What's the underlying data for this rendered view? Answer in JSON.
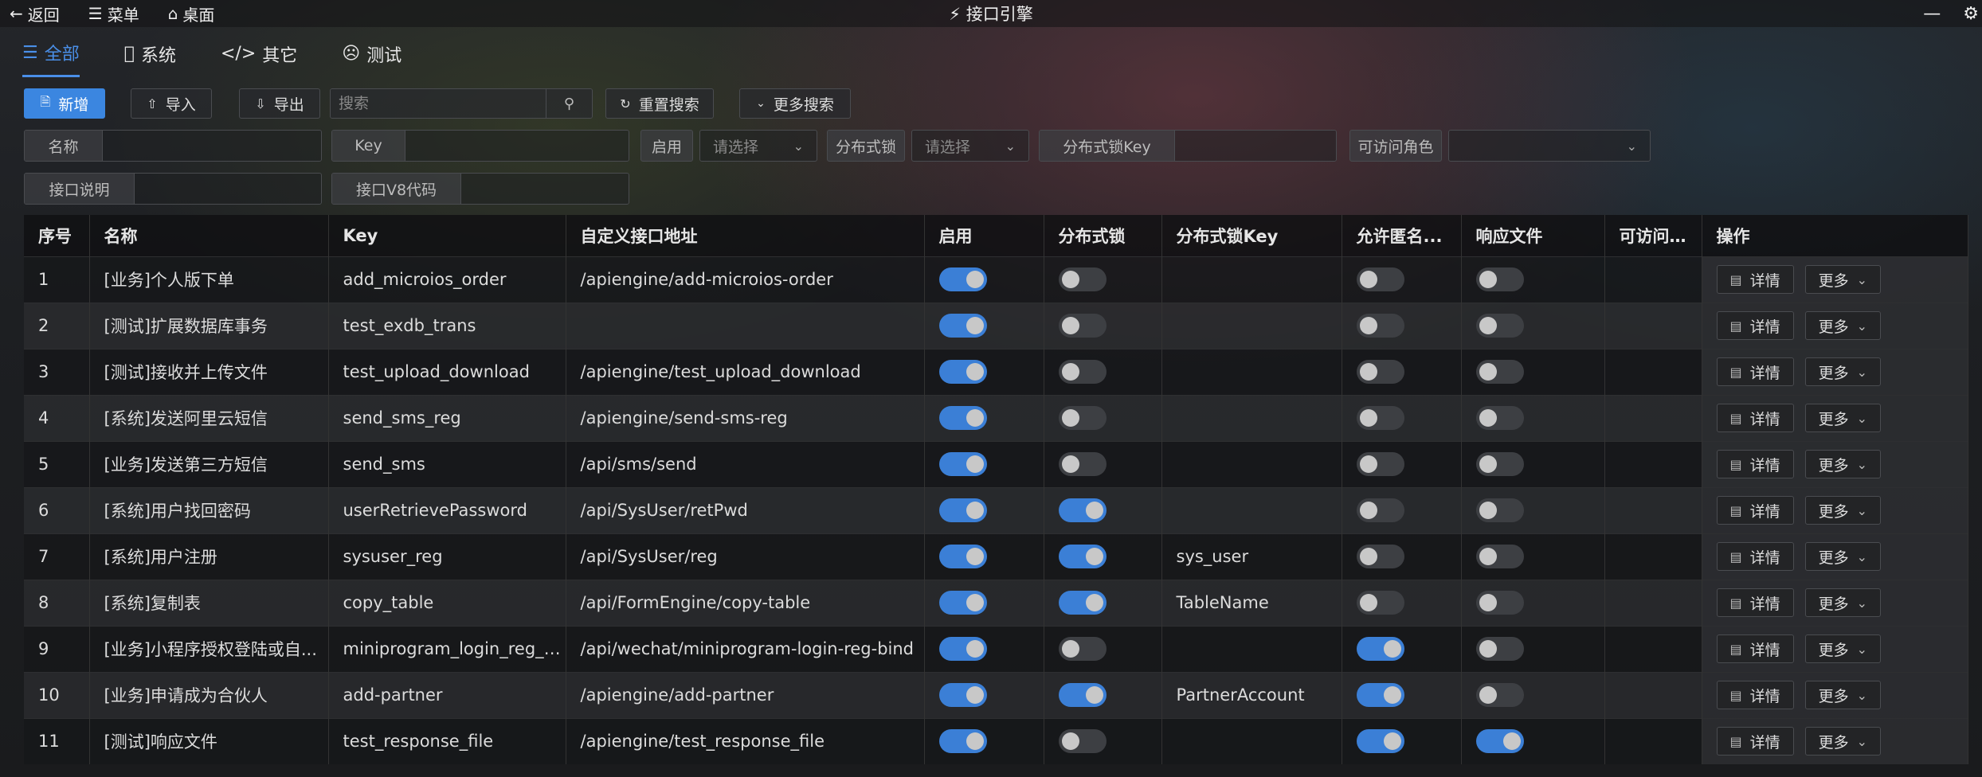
{
  "titlebar": {
    "back": "返回",
    "menu": "菜单",
    "desktop": "桌面",
    "title": "接口引擎",
    "title_icon": "plug-icon"
  },
  "tabs": [
    {
      "label": "全部",
      "icon": "list-icon",
      "active": true
    },
    {
      "label": "系统",
      "icon": "apple-icon",
      "active": false
    },
    {
      "label": "其它",
      "icon": "code-icon",
      "active": false
    },
    {
      "label": "测试",
      "icon": "face-icon",
      "active": false
    }
  ],
  "toolbar": {
    "add": "新增",
    "import": "导入",
    "export": "导出",
    "search_placeholder": "搜索",
    "reset_search": "重置搜索",
    "more_search": "更多搜索"
  },
  "filters": {
    "name": "名称",
    "key": "Key",
    "enabled": "启用",
    "enabled_placeholder": "请选择",
    "dist_lock": "分布式锁",
    "dist_lock_placeholder": "请选择",
    "dist_lock_key": "分布式锁Key",
    "roles": "可访问角色",
    "desc": "接口说明",
    "v8code": "接口V8代码"
  },
  "table": {
    "headers": [
      "序号",
      "名称",
      "Key",
      "自定义接口地址",
      "启用",
      "分布式锁",
      "分布式锁Key",
      "允许匿名...",
      "响应文件",
      "可访问角色",
      "操作"
    ],
    "detail_label": "详情",
    "more_label": "更多",
    "rows": [
      {
        "no": "1",
        "name": "[业务]个人版下单",
        "key": "add_microios_order",
        "url": "/apiengine/add-microios-order",
        "enabled": true,
        "lock": false,
        "lock_key": "",
        "anon": false,
        "resp": false,
        "roles": ""
      },
      {
        "no": "2",
        "name": "[测试]扩展数据库事务",
        "key": "test_exdb_trans",
        "url": "",
        "enabled": true,
        "lock": false,
        "lock_key": "",
        "anon": false,
        "resp": false,
        "roles": ""
      },
      {
        "no": "3",
        "name": "[测试]接收并上传文件",
        "key": "test_upload_download",
        "url": "/apiengine/test_upload_download",
        "enabled": true,
        "lock": false,
        "lock_key": "",
        "anon": false,
        "resp": false,
        "roles": ""
      },
      {
        "no": "4",
        "name": "[系统]发送阿里云短信",
        "key": "send_sms_reg",
        "url": "/apiengine/send-sms-reg",
        "enabled": true,
        "lock": false,
        "lock_key": "",
        "anon": false,
        "resp": false,
        "roles": ""
      },
      {
        "no": "5",
        "name": "[业务]发送第三方短信",
        "key": "send_sms",
        "url": "/api/sms/send",
        "enabled": true,
        "lock": false,
        "lock_key": "",
        "anon": false,
        "resp": false,
        "roles": ""
      },
      {
        "no": "6",
        "name": "[系统]用户找回密码",
        "key": "userRetrievePassword",
        "url": "/api/SysUser/retPwd",
        "enabled": true,
        "lock": true,
        "lock_key": "",
        "anon": false,
        "resp": false,
        "roles": ""
      },
      {
        "no": "7",
        "name": "[系统]用户注册",
        "key": "sysuser_reg",
        "url": "/api/SysUser/reg",
        "enabled": true,
        "lock": true,
        "lock_key": "sys_user",
        "anon": false,
        "resp": false,
        "roles": ""
      },
      {
        "no": "8",
        "name": "[系统]复制表",
        "key": "copy_table",
        "url": "/api/FormEngine/copy-table",
        "enabled": true,
        "lock": true,
        "lock_key": "TableName",
        "anon": false,
        "resp": false,
        "roles": ""
      },
      {
        "no": "9",
        "name": "[业务]小程序授权登陆或自...",
        "key": "miniprogram_login_reg_bi...",
        "url": "/api/wechat/miniprogram-login-reg-bind",
        "enabled": true,
        "lock": false,
        "lock_key": "",
        "anon": true,
        "resp": false,
        "roles": ""
      },
      {
        "no": "10",
        "name": "[业务]申请成为合伙人",
        "key": "add-partner",
        "url": "/apiengine/add-partner",
        "enabled": true,
        "lock": true,
        "lock_key": "PartnerAccount",
        "anon": true,
        "resp": false,
        "roles": ""
      },
      {
        "no": "11",
        "name": "[测试]响应文件",
        "key": "test_response_file",
        "url": "/apiengine/test_response_file",
        "enabled": true,
        "lock": false,
        "lock_key": "",
        "anon": true,
        "resp": true,
        "roles": ""
      }
    ]
  },
  "colors": {
    "accent": "#3b86e0",
    "switch_on": "#3b7fd6",
    "switch_off": "#3d3f43"
  }
}
